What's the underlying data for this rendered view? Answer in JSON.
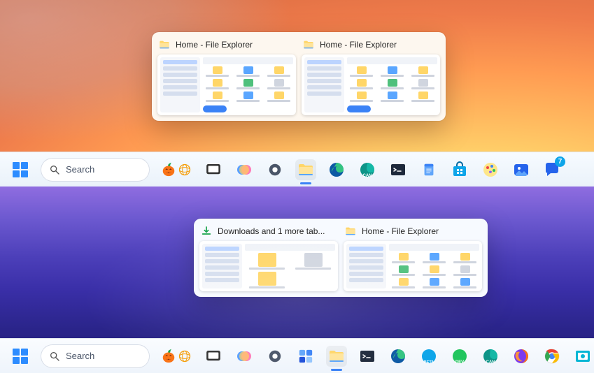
{
  "scene1": {
    "previews": [
      {
        "icon": "folder",
        "title": "Home - File Explorer"
      },
      {
        "icon": "folder",
        "title": "Home - File Explorer"
      }
    ],
    "taskbar": {
      "search_placeholder": "Search",
      "items": [
        {
          "name": "start",
          "active": false
        },
        {
          "name": "task-view",
          "active": false
        },
        {
          "name": "copilot",
          "active": false
        },
        {
          "name": "settings",
          "active": false
        },
        {
          "name": "file-explorer",
          "active": true
        },
        {
          "name": "edge",
          "active": false
        },
        {
          "name": "edge-canary",
          "active": false
        },
        {
          "name": "terminal",
          "active": false
        },
        {
          "name": "notepad",
          "active": false
        },
        {
          "name": "store",
          "active": false
        },
        {
          "name": "paint",
          "active": false
        },
        {
          "name": "photos",
          "active": false
        },
        {
          "name": "chat",
          "active": false,
          "badge": "7"
        }
      ]
    }
  },
  "scene2": {
    "previews": [
      {
        "icon": "download",
        "title": "Downloads and 1 more tab..."
      },
      {
        "icon": "folder",
        "title": "Home - File Explorer"
      }
    ],
    "taskbar": {
      "search_placeholder": "Search",
      "items": [
        {
          "name": "start"
        },
        {
          "name": "task-view"
        },
        {
          "name": "copilot"
        },
        {
          "name": "settings"
        },
        {
          "name": "widgets"
        },
        {
          "name": "file-explorer",
          "active": true
        },
        {
          "name": "terminal"
        },
        {
          "name": "edge"
        },
        {
          "name": "edge-beta"
        },
        {
          "name": "edge-dev"
        },
        {
          "name": "edge-canary"
        },
        {
          "name": "firefox"
        },
        {
          "name": "chrome"
        },
        {
          "name": "screenshot"
        }
      ]
    }
  }
}
